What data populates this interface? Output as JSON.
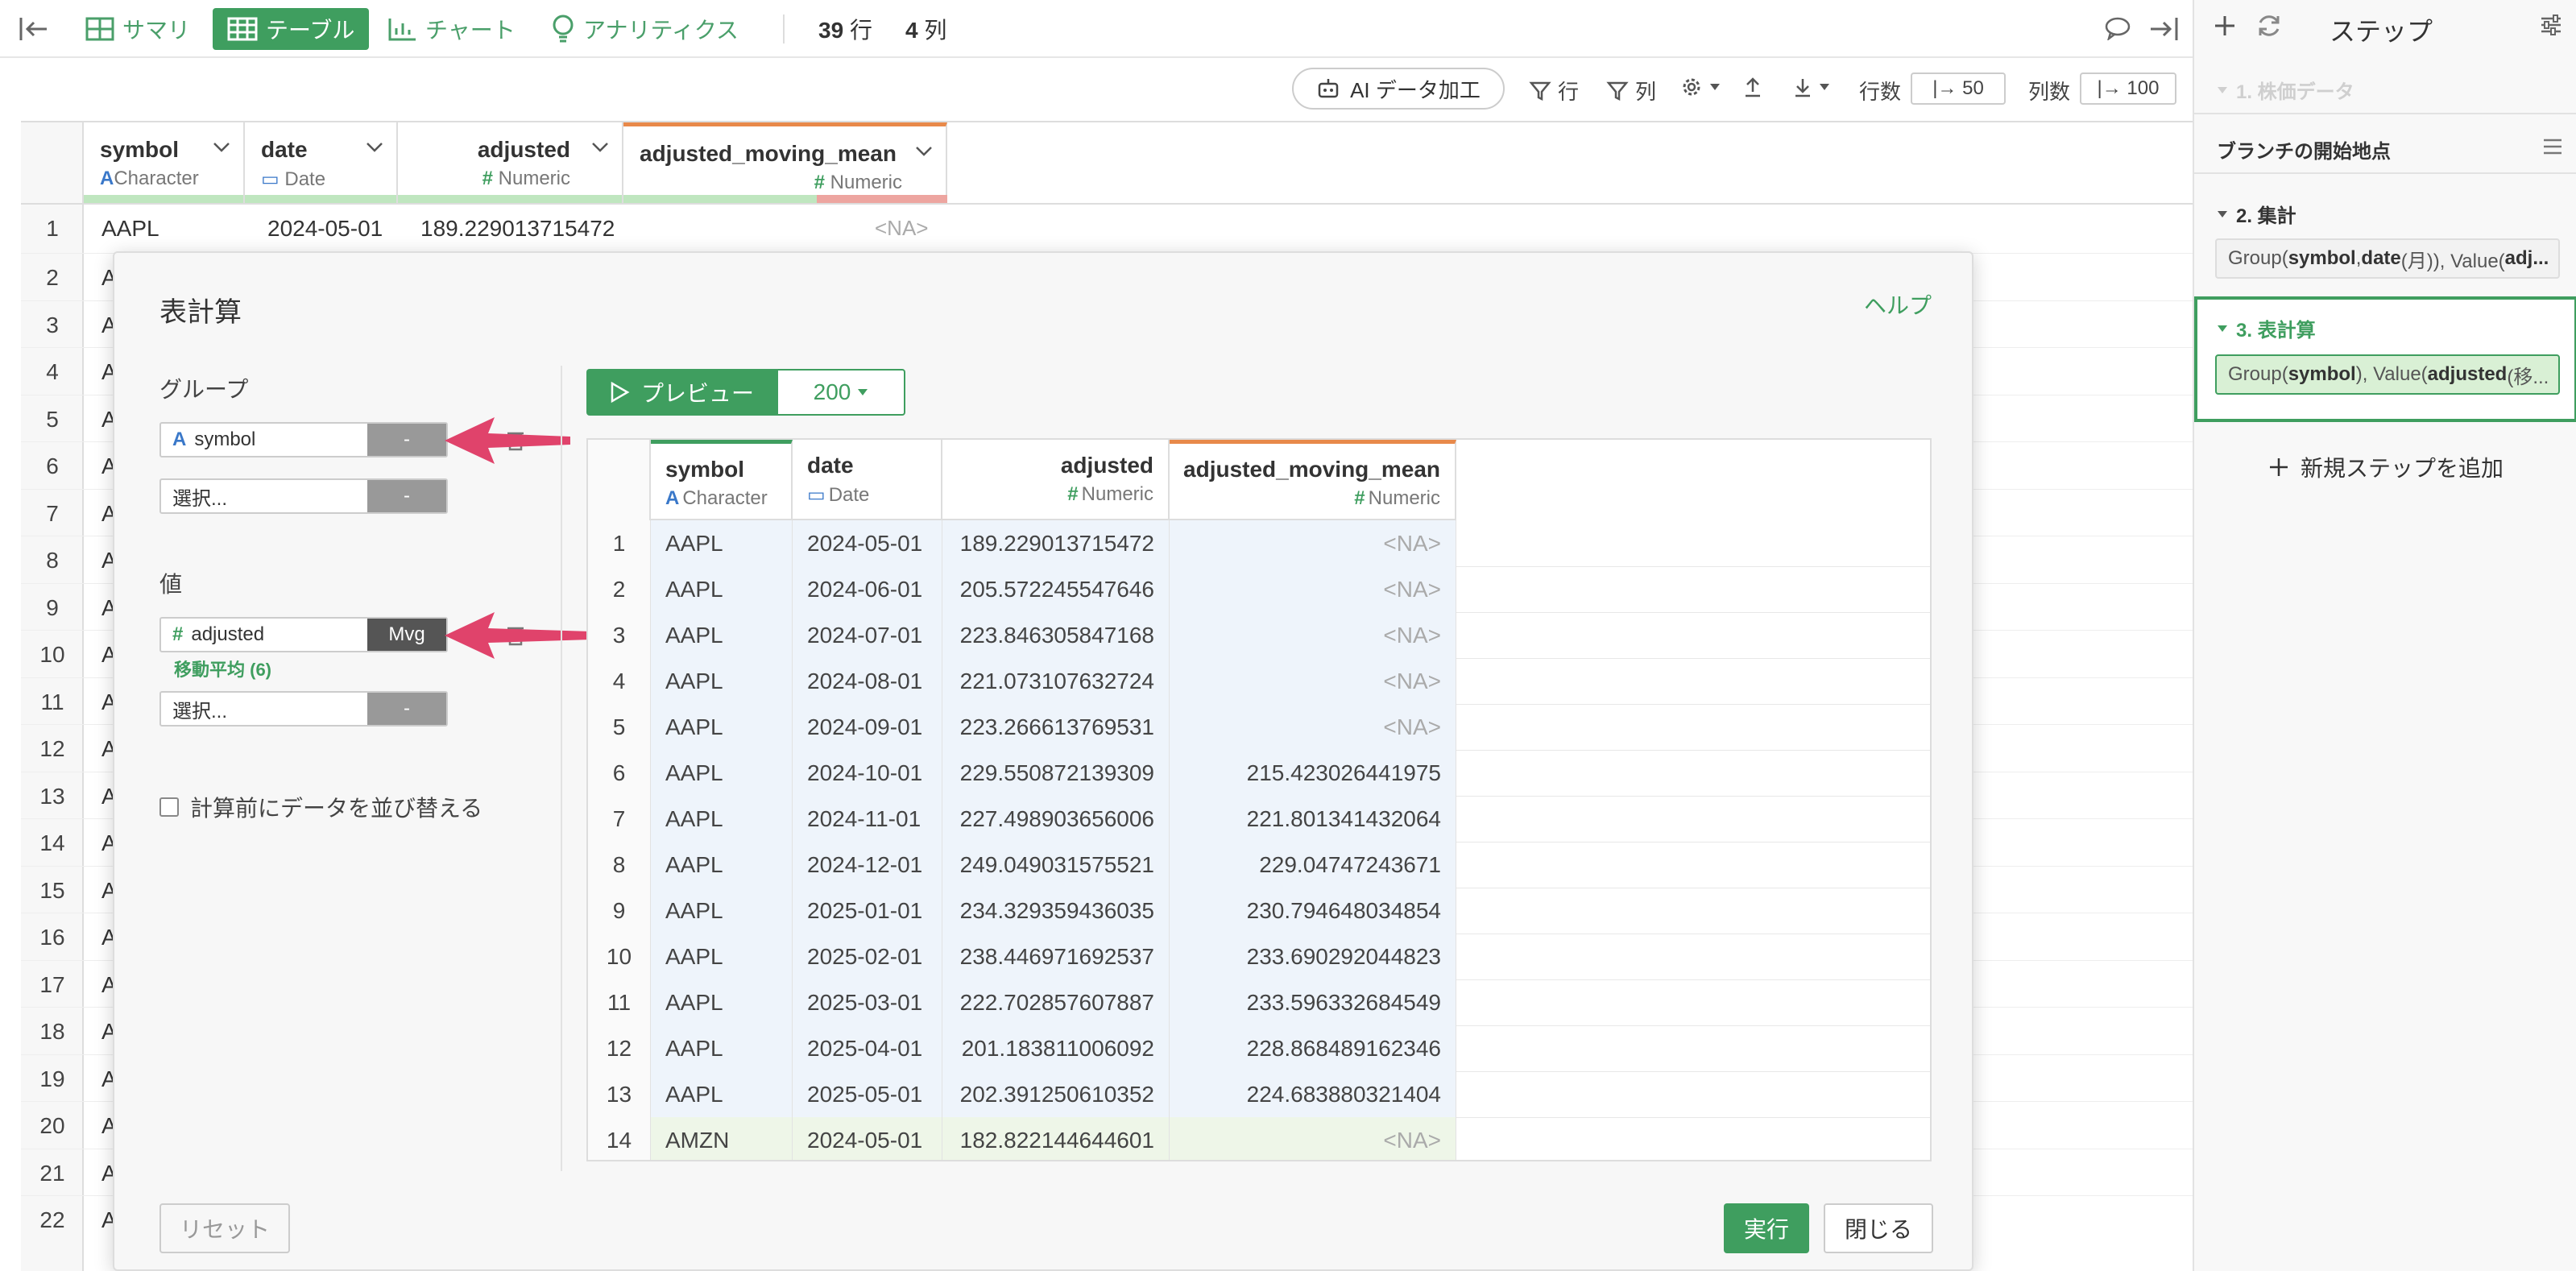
{
  "toolbar": {
    "summary": "サマリ",
    "table": "テーブル",
    "chart": "チャート",
    "analytics": "アナリティクス",
    "rows_num": "39",
    "rows_unit": "行",
    "cols_num": "4",
    "cols_unit": "列"
  },
  "subbar": {
    "ai": "AI データ加工",
    "filter_rows": "行",
    "filter_cols": "列",
    "rows_label": "行数",
    "rows_value": "|→ 50",
    "cols_label": "列数",
    "cols_value": "|→ 100"
  },
  "grid": {
    "columns": [
      {
        "name": "symbol",
        "type": "Character"
      },
      {
        "name": "date",
        "type": "Date"
      },
      {
        "name": "adjusted",
        "type": "Numeric"
      },
      {
        "name": "adjusted_moving_mean",
        "type": "Numeric"
      }
    ],
    "row1": {
      "num": "1",
      "symbol": "AAPL",
      "date": "2024-05-01",
      "adjusted": "189.229013715472",
      "amm": "<NA>"
    },
    "rows": [
      "2",
      "3",
      "4",
      "5",
      "6",
      "7",
      "8",
      "9",
      "10",
      "11",
      "12",
      "13",
      "14",
      "15",
      "16",
      "17",
      "18",
      "19",
      "20",
      "21",
      "22"
    ],
    "row_letter": "A"
  },
  "modal": {
    "title": "表計算",
    "help": "ヘルプ",
    "group_label": "グループ",
    "group_field": "symbol",
    "group_btn": "-",
    "select_placeholder": "選択...",
    "select_btn": "-",
    "value_label": "値",
    "value_field": "adjusted",
    "value_btn": "Mvg",
    "value_note": "移動平均 (6)",
    "value_select": "選択...",
    "value_select_btn": "-",
    "sort_label": "計算前にデータを並び替える",
    "preview": "プレビュー",
    "preview_count": "200",
    "reset": "リセット",
    "run": "実行",
    "close": "閉じる"
  },
  "preview_table": {
    "columns": [
      {
        "name": "symbol",
        "type": "Character"
      },
      {
        "name": "date",
        "type": "Date"
      },
      {
        "name": "adjusted",
        "type": "Numeric"
      },
      {
        "name": "adjusted_moving_mean",
        "type": "Numeric"
      }
    ],
    "rows": [
      [
        "1",
        "AAPL",
        "2024-05-01",
        "189.229013715472",
        "<NA>"
      ],
      [
        "2",
        "AAPL",
        "2024-06-01",
        "205.572245547646",
        "<NA>"
      ],
      [
        "3",
        "AAPL",
        "2024-07-01",
        "223.846305847168",
        "<NA>"
      ],
      [
        "4",
        "AAPL",
        "2024-08-01",
        "221.073107632724",
        "<NA>"
      ],
      [
        "5",
        "AAPL",
        "2024-09-01",
        "223.266613769531",
        "<NA>"
      ],
      [
        "6",
        "AAPL",
        "2024-10-01",
        "229.550872139309",
        "215.423026441975"
      ],
      [
        "7",
        "AAPL",
        "2024-11-01",
        "227.498903656006",
        "221.801341432064"
      ],
      [
        "8",
        "AAPL",
        "2024-12-01",
        "249.049031575521",
        "229.04747243671"
      ],
      [
        "9",
        "AAPL",
        "2025-01-01",
        "234.329359436035",
        "230.794648034854"
      ],
      [
        "10",
        "AAPL",
        "2025-02-01",
        "238.446971692537",
        "233.690292044823"
      ],
      [
        "11",
        "AAPL",
        "2025-03-01",
        "222.702857607887",
        "233.596332684549"
      ],
      [
        "12",
        "AAPL",
        "2025-04-01",
        "201.183811006092",
        "228.868489162346"
      ],
      [
        "13",
        "AAPL",
        "2025-05-01",
        "202.391250610352",
        "224.683880321404"
      ],
      [
        "14",
        "AMZN",
        "2024-05-01",
        "182.822144644601",
        "<NA>"
      ]
    ]
  },
  "sidebar": {
    "title": "ステップ",
    "step1": "1. 株価データ",
    "branch": "ブランチの開始地点",
    "step2": "2. 集計",
    "step2_detail_a": "Group(",
    "step2_detail_b": "symbol",
    "step2_detail_c": ", ",
    "step2_detail_d": "date",
    "step2_detail_e": " (月)), Value(",
    "step2_detail_f": "adj...",
    "step3": "3. 表計算",
    "step3_detail_a": "Group(",
    "step3_detail_b": "symbol",
    "step3_detail_c": "), Value(",
    "step3_detail_d": "adjusted",
    "step3_detail_e": " (移...",
    "add_step": "新規ステップを追加"
  },
  "colors": {
    "accent": "#3f9e5f",
    "annotation_arrow": "#e0436b",
    "na_text": "#aaaaaa",
    "new_column_stripe": "#e8894a"
  }
}
